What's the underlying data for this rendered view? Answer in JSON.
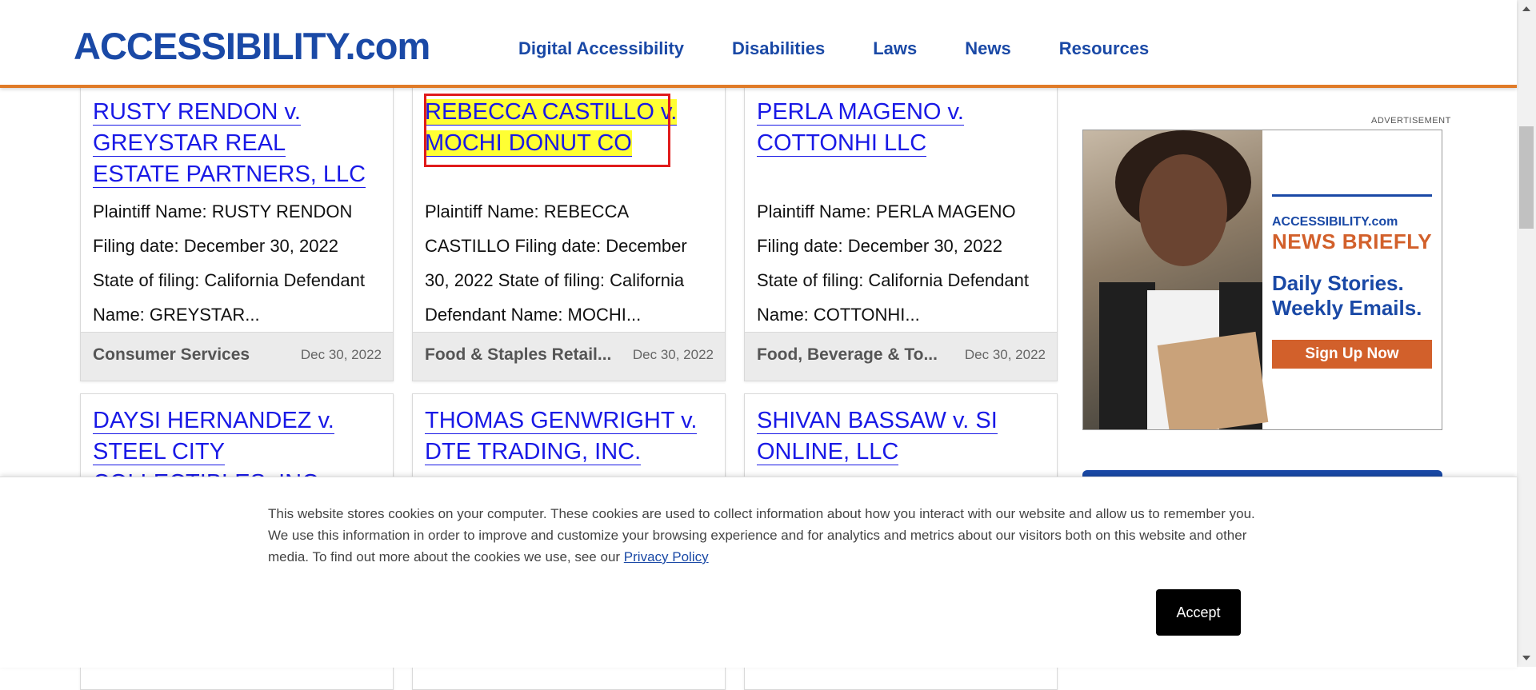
{
  "header": {
    "logo": "ACCESSIBILITY.com",
    "nav": [
      "Digital Accessibility",
      "Disabilities",
      "Laws",
      "News",
      "Resources"
    ]
  },
  "cards": [
    {
      "title": "RUSTY RENDON v. GREYSTAR REAL ESTATE PARTNERS, LLC",
      "desc": "Plaintiff Name: RUSTY RENDON Filing date: December 30, 2022 State of filing: California Defendant Name: GREYSTAR...",
      "category": "Consumer Services",
      "date": "Dec 30, 2022"
    },
    {
      "title": "REBECCA CASTILLO v. MOCHI DONUT CO",
      "desc": "Plaintiff Name: REBECCA CASTILLO Filing date: December 30, 2022 State of filing: California Defendant Name: MOCHI...",
      "category": "Food & Staples Retail...",
      "date": "Dec 30, 2022"
    },
    {
      "title": "PERLA MAGENO v. COTTONHI LLC",
      "desc": "Plaintiff Name: PERLA MAGENO Filing date: December 30, 2022 State of filing: California Defendant Name: COTTONHI...",
      "category": "Food, Beverage & To...",
      "date": "Dec 30, 2022"
    },
    {
      "title": "DAYSI HERNANDEZ v. STEEL CITY COLLECTIBLES, INC."
    },
    {
      "title": "THOMAS GENWRIGHT v. DTE TRADING, INC."
    },
    {
      "title": "SHIVAN BASSAW v. SI ONLINE, LLC"
    }
  ],
  "sidebar": {
    "ad_label": "ADVERTISEMENT",
    "ad_brand": "ACCESSIBILITY.com",
    "ad_headline": "NEWS BRIEFLY",
    "ad_tagline": "Daily Stories. Weekly Emails.",
    "ad_button": "Sign Up Now"
  },
  "cookie": {
    "text": "This website stores cookies on your computer. These cookies are used to collect information about how you interact with our website and allow us to remember you. We use this information in order to improve and customize your browsing experience and for analytics and metrics about our visitors both on this website and other media. To find out more about the cookies we use, see our",
    "link": "Privacy Policy",
    "accept": "Accept"
  }
}
